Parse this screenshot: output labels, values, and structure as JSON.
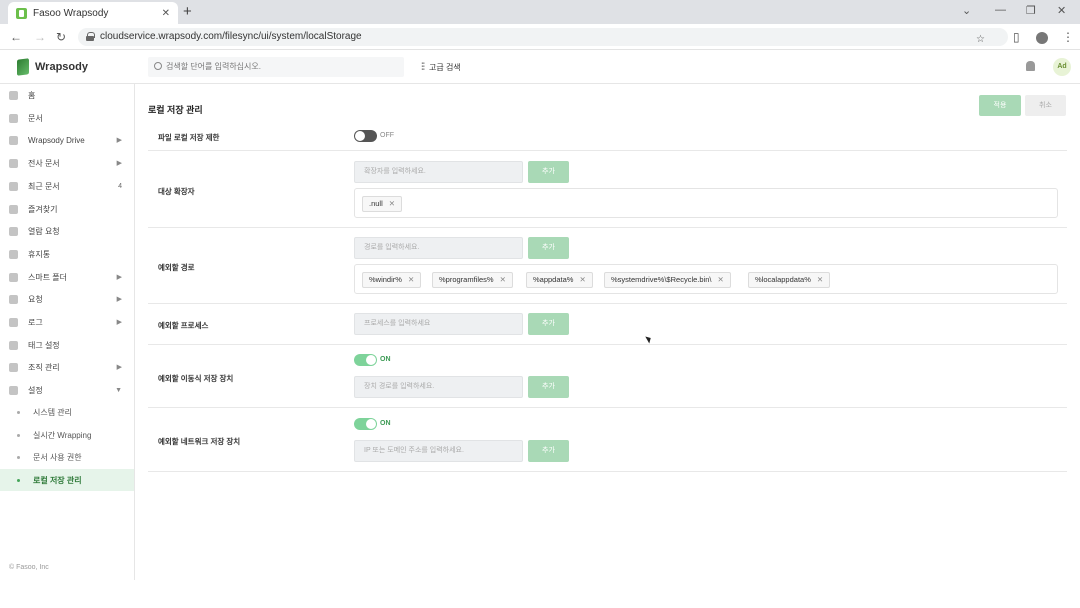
{
  "browser": {
    "tab_title": "Fasoo Wrapsody",
    "url": "cloudservice.wrapsody.com/filesync/ui/system/localStorage"
  },
  "header": {
    "logo": "Wrapsody",
    "search_placeholder": "검색할 단어를 입력하십시오.",
    "advanced_search": "고급 검색",
    "user_initials": "Ad"
  },
  "sidebar": {
    "items": [
      {
        "label": "홈",
        "icon": "home-icon"
      },
      {
        "label": "문서",
        "icon": "document-icon"
      },
      {
        "label": "Wrapsody Drive",
        "icon": "drive-icon",
        "arrow": true
      },
      {
        "label": "전사 문서",
        "icon": "company-icon",
        "arrow": true
      },
      {
        "label": "최근 문서",
        "icon": "recent-icon",
        "count": "4"
      },
      {
        "label": "즐겨찾기",
        "icon": "star-icon"
      },
      {
        "label": "열람 요청",
        "icon": "request-icon"
      },
      {
        "label": "휴지통",
        "icon": "trash-icon"
      },
      {
        "label": "스마트 폴더",
        "icon": "smart-folder-icon",
        "arrow": true
      },
      {
        "label": "요청",
        "icon": "request2-icon",
        "arrow": true
      },
      {
        "label": "로그",
        "icon": "log-icon",
        "arrow": true
      },
      {
        "label": "태그 설정",
        "icon": "tag-icon"
      },
      {
        "label": "조직 관리",
        "icon": "org-icon",
        "arrow": true
      },
      {
        "label": "설정",
        "icon": "settings-icon",
        "expanded": true
      }
    ],
    "sub_items": [
      {
        "label": "시스템 관리"
      },
      {
        "label": "실시간 Wrapping"
      },
      {
        "label": "문서 사용 권한"
      },
      {
        "label": "로컬 저장 관리",
        "active": true
      }
    ],
    "copyright": "© Fasoo, Inc"
  },
  "main": {
    "title": "로컬 저장 관리",
    "apply": "적용",
    "cancel": "취소",
    "file_local_save": {
      "label": "파일 로컬 저장 제한",
      "state": "OFF"
    },
    "target_ext": {
      "label": "대상 확장자",
      "placeholder": "확장자를 입력하세요.",
      "add": "추가",
      "chips": [
        ".null"
      ]
    },
    "exclude_path": {
      "label": "예외할 경로",
      "placeholder": "경로를 입력하세요.",
      "add": "추가",
      "chips": [
        "%windir%",
        "%programfiles%",
        "%appdata%",
        "%systemdrive%\\$Recycle.bin\\",
        "%localappdata%"
      ]
    },
    "exclude_process": {
      "label": "예외할 프로세스",
      "placeholder": "프로세스를 입력하세요",
      "add": "추가"
    },
    "exclude_removable": {
      "label": "예외할 이동식 저장 장치",
      "state": "ON",
      "placeholder": "장치 경로를 입력하세요.",
      "add": "추가"
    },
    "exclude_network": {
      "label": "예외할 네트워크 저장 장치",
      "state": "ON",
      "placeholder": "IP 또는 도메인 주소를 입력하세요.",
      "add": "추가"
    }
  }
}
